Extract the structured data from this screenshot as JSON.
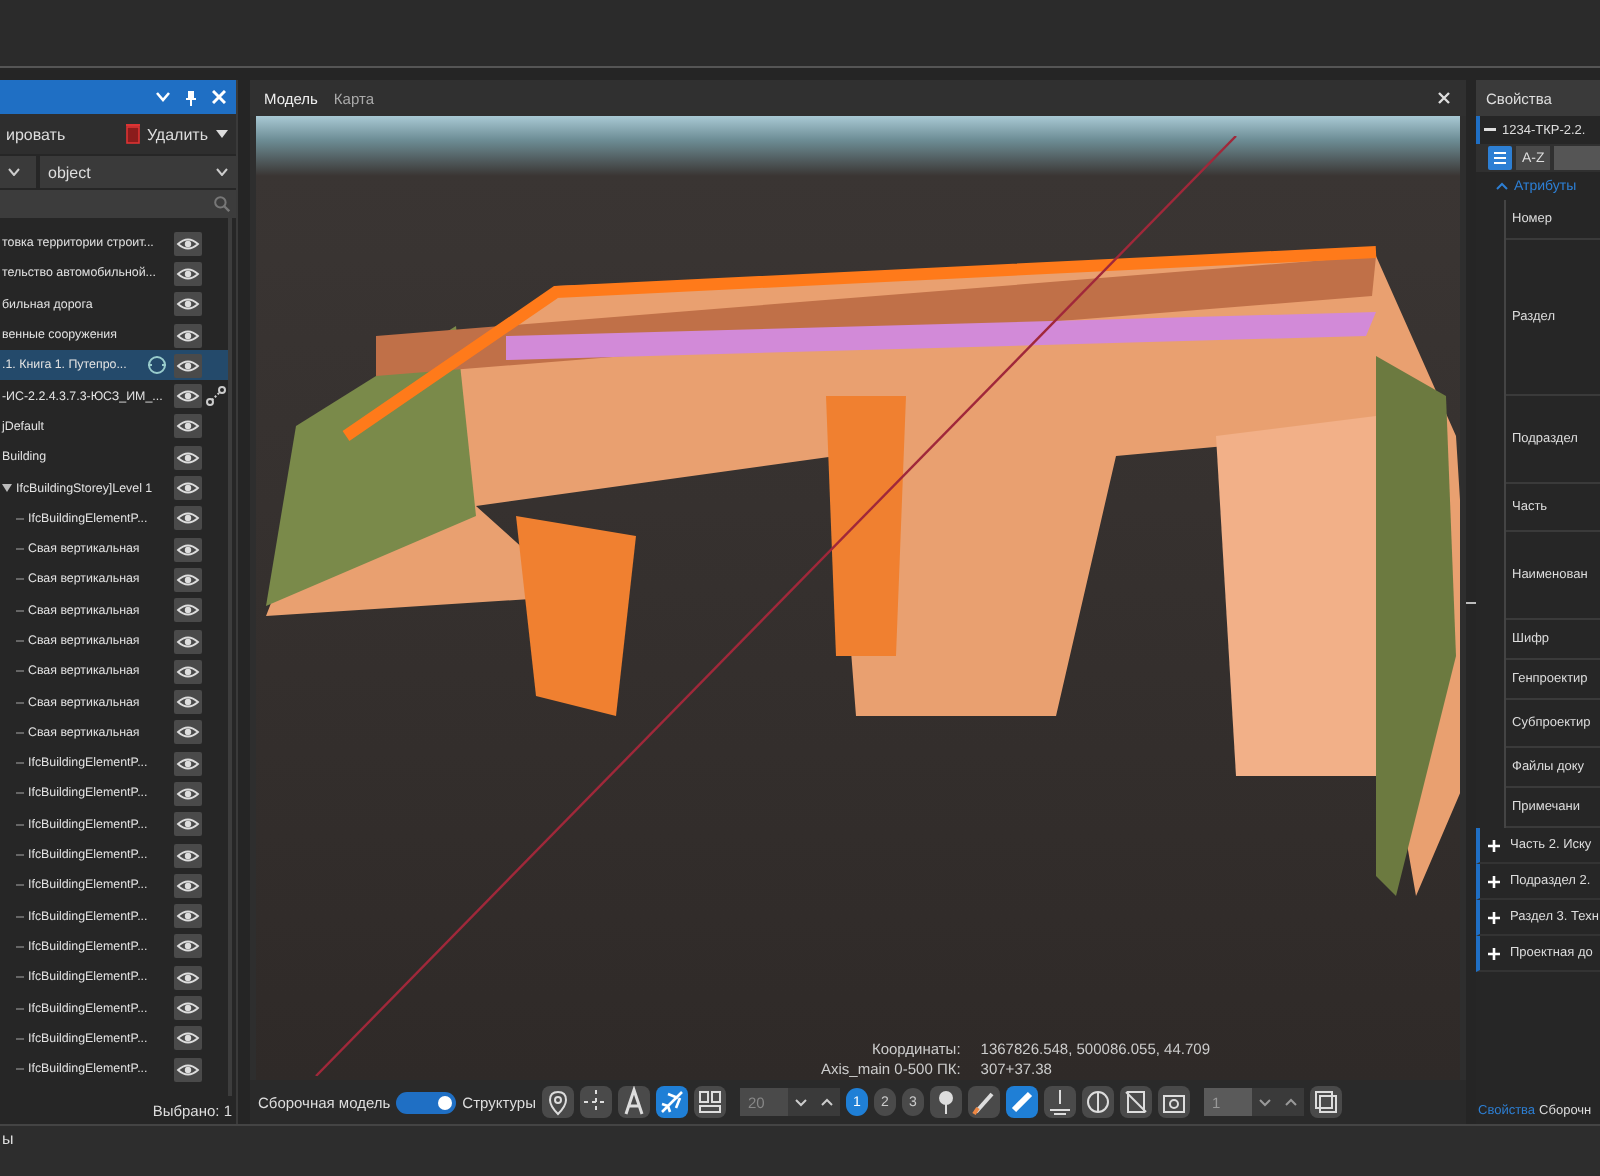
{
  "left_panel": {
    "toolbar": {
      "copy_label": "ировать",
      "delete_label": "Удалить"
    },
    "filter": {
      "value": "object"
    },
    "tree": [
      {
        "label": "товка территории строит...",
        "selected": false
      },
      {
        "label": "тельство автомобильной...",
        "selected": false
      },
      {
        "label": "бильная дорога",
        "selected": false
      },
      {
        "label": "венные сооружения",
        "selected": false
      },
      {
        "label": ".1. Книга 1. Путепро...",
        "selected": true,
        "synced": true
      },
      {
        "label": "-ИС-2.2.4.3.7.3-ЮСЗ_ИМ_...",
        "selected": false,
        "linked": true
      },
      {
        "label": "jDefault",
        "selected": false
      },
      {
        "label": "Building",
        "selected": false
      },
      {
        "label": "IfcBuildingStorey]Level 1",
        "selected": false,
        "expanded": true,
        "children": [
          {
            "label": "IfcBuildingElementP...",
            "selected": false
          },
          {
            "label": "Свая вертикальная",
            "selected": false
          },
          {
            "label": "Свая вертикальная",
            "selected": false
          },
          {
            "label": "Свая вертикальная",
            "selected": false
          },
          {
            "label": "Свая вертикальная",
            "selected": false
          },
          {
            "label": "Свая вертикальная",
            "selected": false
          },
          {
            "label": "Свая вертикальная",
            "selected": false
          },
          {
            "label": "Свая вертикальная",
            "selected": false
          },
          {
            "label": "IfcBuildingElementP...",
            "selected": false
          },
          {
            "label": "IfcBuildingElementP...",
            "selected": false
          },
          {
            "label": "IfcBuildingElementP...",
            "selected": false
          },
          {
            "label": "IfcBuildingElementP...",
            "selected": false
          },
          {
            "label": "IfcBuildingElementP...",
            "selected": false
          },
          {
            "label": "IfcBuildingElementP...",
            "selected": false
          },
          {
            "label": "IfcBuildingElementP...",
            "selected": false
          },
          {
            "label": "IfcBuildingElementP...",
            "selected": false
          },
          {
            "label": "IfcBuildingElementP...",
            "selected": false
          },
          {
            "label": "IfcBuildingElementP...",
            "selected": false
          },
          {
            "label": "IfcBuildingElementP...",
            "selected": false
          }
        ]
      }
    ],
    "status": "Выбрано: 1",
    "bottom_tab": "ы"
  },
  "viewport": {
    "tabs": [
      {
        "label": "Модель",
        "selected": true
      },
      {
        "label": "Карта",
        "selected": false
      }
    ],
    "coordinates_label": "Координаты:",
    "coordinates_value": "1367826.548, 500086.055, 44.709",
    "axis_label": "Axis_main 0-500 ПК:",
    "axis_value": "307+37.38"
  },
  "toolbar": {
    "left_label": "Сборочная модель",
    "toggle_on": true,
    "right_label": "Структуры",
    "tools_a": [
      {
        "selected": false
      },
      {
        "selected": false
      },
      {
        "selected": false
      },
      {
        "selected": true
      },
      {
        "selected": false
      }
    ],
    "zoom_value": "20",
    "pages": [
      {
        "label": "1",
        "selected": true
      },
      {
        "label": "2",
        "selected": false
      },
      {
        "label": "3",
        "selected": false
      }
    ],
    "tools_b": [
      {
        "selected": false
      },
      {
        "selected": false
      },
      {
        "selected": true
      },
      {
        "selected": false
      },
      {
        "selected": false
      },
      {
        "selected": false
      },
      {
        "selected": false
      }
    ],
    "frame_value": "1"
  },
  "properties": {
    "title": "Свойства",
    "document": "1234-ТКР-2.2.",
    "sort_label": "A-Z",
    "group": "Атрибуты",
    "attributes": [
      "Номер",
      "Раздел",
      "Подраздел",
      "Часть",
      "Наименован",
      "Шифр",
      "Генпроектир",
      "Субпроектир",
      "Файлы доку",
      "Примечани"
    ],
    "sections": [
      "Часть 2. Иску",
      "Подраздел 2.",
      "Раздел 3. Техн",
      "Проектная до"
    ],
    "bottom_tabs": [
      {
        "label": "Свойства",
        "selected": true
      },
      {
        "label": "Сборочн",
        "selected": false
      }
    ]
  }
}
